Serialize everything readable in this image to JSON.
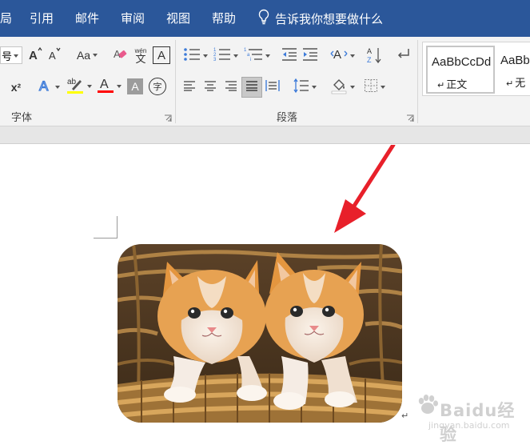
{
  "tabs": [
    {
      "label": "局"
    },
    {
      "label": "引用"
    },
    {
      "label": "邮件"
    },
    {
      "label": "审阅"
    },
    {
      "label": "视图"
    },
    {
      "label": "帮助"
    }
  ],
  "tell_me": {
    "label": "告诉我你想要做什么",
    "icon": "lightbulb-icon"
  },
  "ribbon": {
    "font_group": {
      "label": "字体",
      "font_size_value": "号",
      "buttons": [
        "grow-font",
        "shrink-font",
        "change-case",
        "clear-formatting",
        "phonetic-guide",
        "character-border",
        "superscript",
        "text-effects",
        "text-highlight",
        "font-color",
        "character-shading",
        "enclose-characters"
      ],
      "change_case_label": "Aa",
      "phonetic_label": "wén",
      "phonetic_char": "文",
      "border_char_label": "A",
      "superscript_label": "x²",
      "highlight_color": "#ffff00",
      "font_color": "#ff0000",
      "enclose_char": "字"
    },
    "paragraph_group": {
      "label": "段落",
      "sort_label": "A↓",
      "buttons": [
        "bullets",
        "numbering",
        "multilevel-list",
        "decrease-indent",
        "increase-indent",
        "asian-layout",
        "sort",
        "show-marks",
        "align-left",
        "center",
        "align-right",
        "justify",
        "distributed",
        "line-spacing",
        "shading",
        "borders"
      ],
      "selected": "justify"
    },
    "styles_group": {
      "items": [
        {
          "sample": "AaBbCcDd",
          "name": "正文"
        },
        {
          "sample": "AaBbC",
          "name": "无"
        }
      ],
      "return_mark": "↵"
    }
  },
  "document": {
    "picture_alt": "Two kittens in a wicker basket",
    "paragraph_mark": "↵"
  },
  "annotation": {
    "type": "red-arrow",
    "color": "#e8202a"
  },
  "watermark": {
    "text": "Baidu经验",
    "sub": "jingyan.baidu.com"
  },
  "colors": {
    "ribbon_tab_bg": "#2b579a",
    "ribbon_bg": "#f3f3f3",
    "accent_red": "#e8202a"
  }
}
